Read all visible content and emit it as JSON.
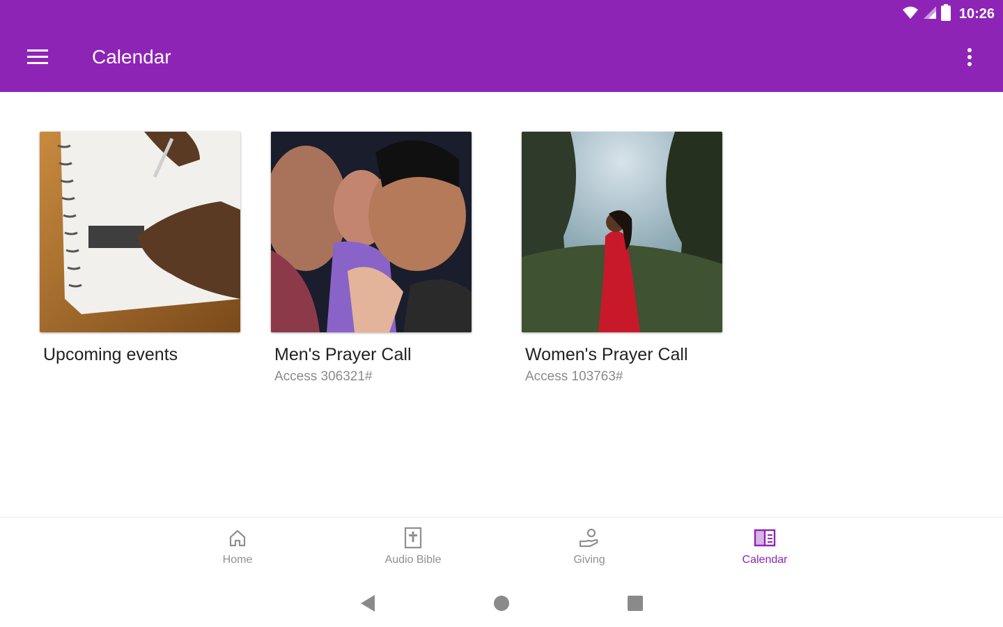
{
  "status_bar": {
    "time": "10:26",
    "icons": [
      "wifi-icon",
      "signal-icon",
      "battery-icon"
    ]
  },
  "toolbar": {
    "title": "Calendar",
    "menu_icon": "hamburger-menu-icon",
    "overflow_icon": "more-vert-icon"
  },
  "cards": [
    {
      "title": "Upcoming events",
      "subtitle": "",
      "image": "notebook-writing-photo"
    },
    {
      "title": "Men's Prayer Call",
      "subtitle": "Access 306321#",
      "image": "men-praying-photo"
    },
    {
      "title": "Women's Prayer Call",
      "subtitle": "Access 103763#",
      "image": "woman-praying-forest-photo"
    }
  ],
  "bottom_nav": {
    "items": [
      {
        "label": "Home",
        "icon": "home-icon",
        "active": false
      },
      {
        "label": "Audio Bible",
        "icon": "bible-icon",
        "active": false
      },
      {
        "label": "Giving",
        "icon": "giving-hand-icon",
        "active": false
      },
      {
        "label": "Calendar",
        "icon": "calendar-icon",
        "active": true
      }
    ]
  },
  "system_nav": {
    "buttons": [
      "back-icon",
      "home-circle-icon",
      "recents-icon"
    ]
  },
  "colors": {
    "primary": "#8e24b6",
    "inactive": "#8f8f8f",
    "title_text": "#212121",
    "subtitle_text": "#8a8a8a"
  }
}
